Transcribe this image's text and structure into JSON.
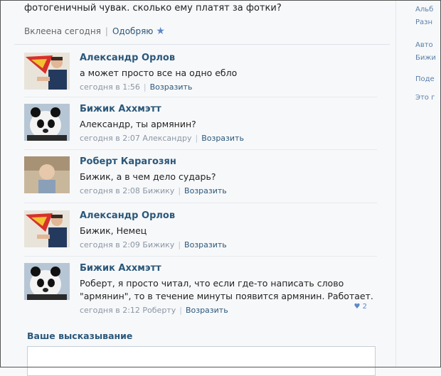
{
  "post": {
    "text": "фотогеничный чувак. сколько ему платят за фотки?",
    "pasted": "Вклеена сегодня",
    "like": "Одобряю"
  },
  "comments": [
    {
      "author": "Александр Орлов",
      "text": "а может просто все на одно еблo",
      "time": "сегодня в 1:56",
      "reply": "Возразить",
      "avatar": "superman"
    },
    {
      "author": "Бижик Аххмэтт",
      "text": "Александр, ты армянин?",
      "time": "сегодня в 2:07 Александру",
      "reply": "Возразить",
      "avatar": "panda"
    },
    {
      "author": "Роберт Карагозян",
      "text": "Бижик, а в чем дело сударь?",
      "time": "сегодня в 2:08 Бижику",
      "reply": "Возразить",
      "avatar": "child"
    },
    {
      "author": "Александр Орлов",
      "text": "Бижик, Немец",
      "time": "сегодня в 2:09 Бижику",
      "reply": "Возразить",
      "avatar": "superman"
    },
    {
      "author": "Бижик Аххмэтт",
      "text1": "Роберт, я просто читал, что если где-то написать слово",
      "text2": "\"армянин\", то в течение минуты появится армянин. Работает.",
      "time": "сегодня в 2:12 Роберту",
      "reply": "Возразить",
      "avatar": "panda",
      "likes": "2"
    }
  ],
  "composer": {
    "title": "Ваше высказывание"
  },
  "sidebar": {
    "items": [
      "Альб",
      "Разн",
      "Авто",
      "Бижи",
      "Поде",
      "Это г"
    ]
  }
}
